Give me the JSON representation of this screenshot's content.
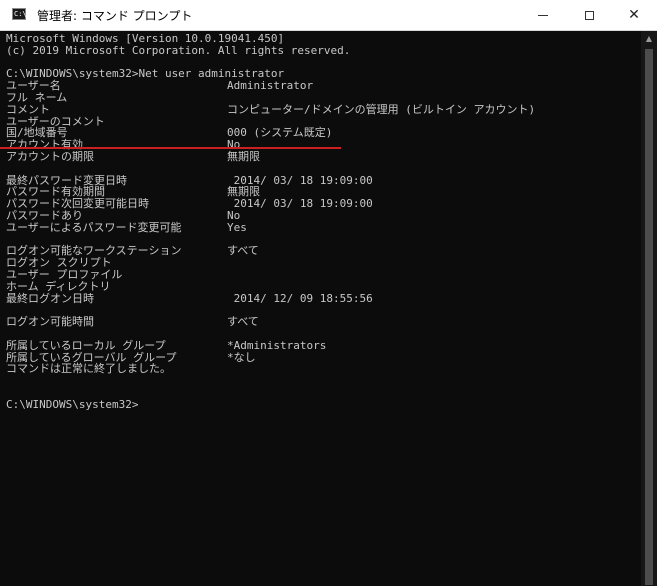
{
  "window": {
    "title": "管理者: コマンド プロンプト",
    "app_icon_text": "C:\\",
    "controls": {
      "minimize": "minimize-icon",
      "maximize": "maximize-icon",
      "close": "✕"
    }
  },
  "console": {
    "header": [
      "Microsoft Windows [Version 10.0.19041.450]",
      "(c) 2019 Microsoft Corporation. All rights reserved."
    ],
    "command": "C:\\WINDOWS\\system32>Net user administrator",
    "fields": [
      {
        "label": "ユーザー名",
        "value": "Administrator"
      },
      {
        "label": "フル ネーム",
        "value": ""
      },
      {
        "label": "コメント",
        "value": "コンピューター/ドメインの管理用 (ビルトイン アカウント)"
      },
      {
        "label": "ユーザーのコメント",
        "value": ""
      },
      {
        "label": "国/地域番号",
        "value": "000 (システム既定)"
      },
      {
        "label": "アカウント有効",
        "value": "No"
      },
      {
        "label": "アカウントの期限",
        "value": "無期限"
      },
      {
        "label": "",
        "value": ""
      },
      {
        "label": "最終パスワード変更日時",
        "value": " 2014/ 03/ 18 19:09:00"
      },
      {
        "label": "パスワード有効期間",
        "value": "無期限"
      },
      {
        "label": "パスワード次回変更可能日時",
        "value": " 2014/ 03/ 18 19:09:00"
      },
      {
        "label": "パスワードあり",
        "value": "No"
      },
      {
        "label": "ユーザーによるパスワード変更可能",
        "value": "Yes"
      },
      {
        "label": "",
        "value": ""
      },
      {
        "label": "ログオン可能なワークステーション",
        "value": "すべて"
      },
      {
        "label": "ログオン スクリプト",
        "value": ""
      },
      {
        "label": "ユーザー プロファイル",
        "value": ""
      },
      {
        "label": "ホーム ディレクトリ",
        "value": ""
      },
      {
        "label": "最終ログオン日時",
        "value": " 2014/ 12/ 09 18:55:56"
      },
      {
        "label": "",
        "value": ""
      },
      {
        "label": "ログオン可能時間",
        "value": "すべて"
      },
      {
        "label": "",
        "value": ""
      },
      {
        "label": "所属しているローカル グループ",
        "value": "*Administrators"
      },
      {
        "label": "所属しているグローバル グループ",
        "value": "*なし"
      }
    ],
    "completion": "コマンドは正常に終了しました。",
    "prompt": "C:\\WINDOWS\\system32>"
  },
  "annotation": {
    "underline_color": "#cc1f1f"
  },
  "colors": {
    "console_bg": "#0c0c0c",
    "console_text": "#c8c8c8",
    "titlebar_bg": "#ffffff"
  }
}
